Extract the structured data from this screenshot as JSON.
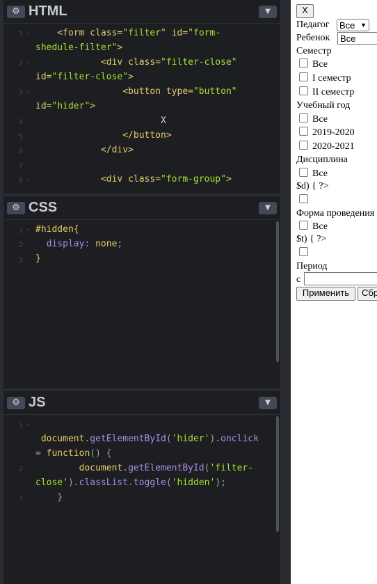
{
  "editor": {
    "html_panel": {
      "title": "HTML",
      "lines": [
        {
          "num": "1",
          "fold": "▾",
          "segments": [
            {
              "t": "    <form ",
              "c": "t-tag"
            },
            {
              "t": "class=",
              "c": "t-attr"
            },
            {
              "t": "\"filter\"",
              "c": "t-str"
            },
            {
              "t": " id=",
              "c": "t-attr"
            },
            {
              "t": "\"form-",
              "c": "t-str"
            }
          ]
        },
        {
          "num": "",
          "fold": "",
          "segments": [
            {
              "t": "shedule-filter\"",
              "c": "t-str"
            },
            {
              "t": ">",
              "c": "t-tag"
            }
          ]
        },
        {
          "num": "2",
          "fold": "▾",
          "segments": [
            {
              "t": "            <div ",
              "c": "t-tag"
            },
            {
              "t": "class=",
              "c": "t-attr"
            },
            {
              "t": "\"filter-close\"",
              "c": "t-str"
            }
          ]
        },
        {
          "num": "",
          "fold": "",
          "segments": [
            {
              "t": "id=",
              "c": "t-attr"
            },
            {
              "t": "\"filter-close\"",
              "c": "t-str"
            },
            {
              "t": ">",
              "c": "t-tag"
            }
          ]
        },
        {
          "num": "3",
          "fold": "▾",
          "segments": [
            {
              "t": "                <button ",
              "c": "t-tag"
            },
            {
              "t": "type=",
              "c": "t-attr"
            },
            {
              "t": "\"button\"",
              "c": "t-str"
            }
          ]
        },
        {
          "num": "",
          "fold": "",
          "segments": [
            {
              "t": "id=",
              "c": "t-attr"
            },
            {
              "t": "\"hider\"",
              "c": "t-str"
            },
            {
              "t": ">",
              "c": "t-tag"
            }
          ]
        },
        {
          "num": "4",
          "fold": "",
          "segments": [
            {
              "t": "                       X",
              "c": "t-plain"
            }
          ]
        },
        {
          "num": "5",
          "fold": "",
          "segments": [
            {
              "t": "                </button>",
              "c": "t-tag"
            }
          ]
        },
        {
          "num": "6",
          "fold": "",
          "segments": [
            {
              "t": "            </div>",
              "c": "t-tag"
            }
          ]
        },
        {
          "num": "7",
          "fold": "",
          "segments": [
            {
              "t": "",
              "c": "t-plain"
            }
          ]
        },
        {
          "num": "8",
          "fold": "▾",
          "segments": [
            {
              "t": "            <div ",
              "c": "t-tag"
            },
            {
              "t": "class=",
              "c": "t-attr"
            },
            {
              "t": "\"form-group\"",
              "c": "t-str"
            },
            {
              "t": ">",
              "c": "t-tag"
            }
          ]
        }
      ]
    },
    "css_panel": {
      "title": "CSS",
      "lines": [
        {
          "num": "1",
          "fold": "▾",
          "segments": [
            {
              "t": "#hidden{",
              "c": "t-sel"
            }
          ]
        },
        {
          "num": "2",
          "fold": "",
          "segments": [
            {
              "t": "  display",
              "c": "t-prop"
            },
            {
              "t": ": ",
              "c": "t-punc"
            },
            {
              "t": "none",
              "c": "t-val"
            },
            {
              "t": ";",
              "c": "t-punc"
            }
          ]
        },
        {
          "num": "3",
          "fold": "",
          "segments": [
            {
              "t": "}",
              "c": "t-sel"
            }
          ]
        }
      ]
    },
    "js_panel": {
      "title": "JS",
      "lines": [
        {
          "num": "1",
          "fold": "▾",
          "segments": [
            {
              "t": "",
              "c": "t-plain"
            }
          ]
        },
        {
          "num": "",
          "fold": "",
          "segments": [
            {
              "t": " document",
              "c": "t-obj"
            },
            {
              "t": ".",
              "c": "t-punc"
            },
            {
              "t": "getElementById",
              "c": "t-meth"
            },
            {
              "t": "(",
              "c": "t-punc"
            },
            {
              "t": "'hider'",
              "c": "t-strjs"
            },
            {
              "t": ").",
              "c": "t-punc"
            },
            {
              "t": "onclick",
              "c": "t-meth"
            }
          ]
        },
        {
          "num": "",
          "fold": "",
          "segments": [
            {
              "t": "= ",
              "c": "t-punc"
            },
            {
              "t": "function",
              "c": "t-kw"
            },
            {
              "t": "() {",
              "c": "t-punc"
            }
          ]
        },
        {
          "num": "2",
          "fold": "",
          "segments": [
            {
              "t": "        document",
              "c": "t-obj"
            },
            {
              "t": ".",
              "c": "t-punc"
            },
            {
              "t": "getElementById",
              "c": "t-meth"
            },
            {
              "t": "(",
              "c": "t-punc"
            },
            {
              "t": "'filter-",
              "c": "t-strjs"
            }
          ]
        },
        {
          "num": "",
          "fold": "",
          "segments": [
            {
              "t": "close'",
              "c": "t-strjs"
            },
            {
              "t": ").",
              "c": "t-punc"
            },
            {
              "t": "classList",
              "c": "t-meth"
            },
            {
              "t": ".",
              "c": "t-punc"
            },
            {
              "t": "toggle",
              "c": "t-meth"
            },
            {
              "t": "(",
              "c": "t-punc"
            },
            {
              "t": "'hidden'",
              "c": "t-strjs"
            },
            {
              "t": ");",
              "c": "t-punc"
            }
          ]
        },
        {
          "num": "3",
          "fold": "",
          "segments": [
            {
              "t": "    }",
              "c": "t-punc"
            }
          ]
        }
      ]
    }
  },
  "preview": {
    "close_button": "X",
    "teacher_label": "Педагог",
    "teacher_select": "Все",
    "child_label": "Ребенок",
    "child_select": "Все",
    "semester_heading": "Семестр",
    "semester_all": "Все",
    "semester_1": "I семестр",
    "semester_2": "II семестр",
    "year_heading": "Учебный год",
    "year_all": "Все",
    "year_2019": "2019-2020",
    "year_2020": "2020-2021",
    "discipline_heading": "Дисциплина",
    "discipline_all": "Все",
    "discipline_php_leak": "$d) { ?>",
    "form_heading": "Форма проведения",
    "form_all": "Все",
    "form_php_leak": "$t) { ?>",
    "period_heading": "Период",
    "period_from": "с",
    "apply_button": "Применить",
    "reset_button": "Сбросить"
  }
}
